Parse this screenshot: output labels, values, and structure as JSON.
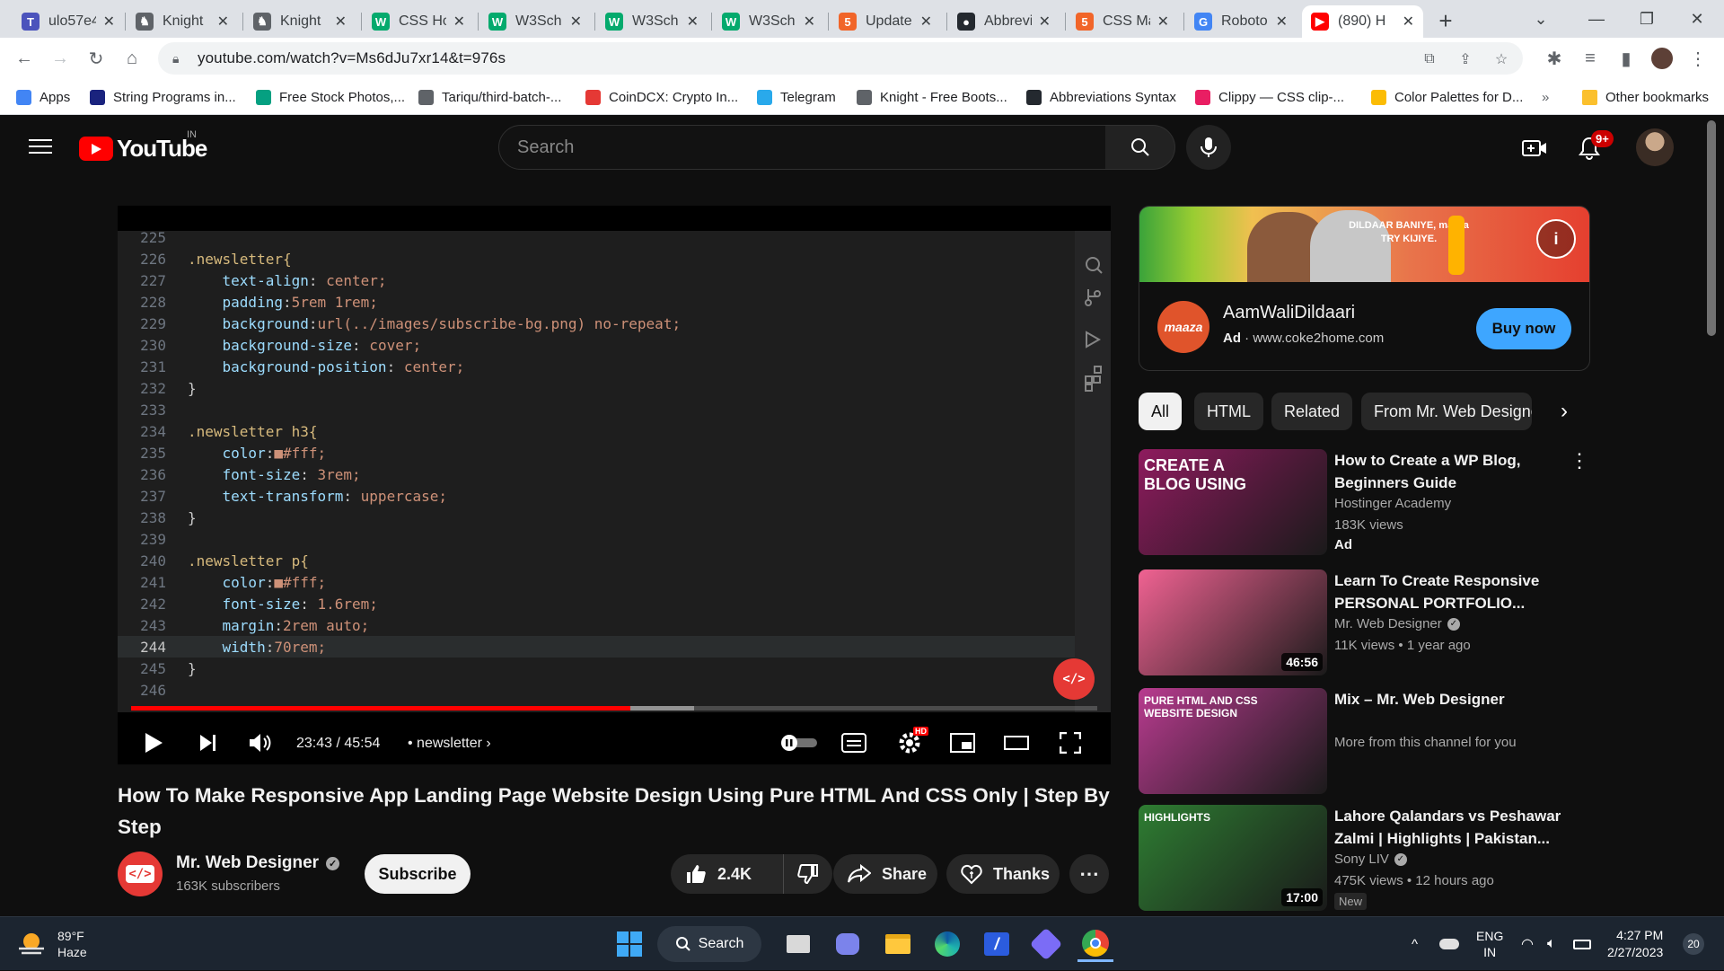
{
  "browser": {
    "tabs": [
      {
        "label": "ulo57e4",
        "icon": "teams-icon",
        "color": "#4b53bc"
      },
      {
        "label": "Knight",
        "icon": "knight-icon",
        "color": "#5f6368"
      },
      {
        "label": "Knight",
        "icon": "knight-icon",
        "color": "#5f6368"
      },
      {
        "label": "CSS Ho",
        "icon": "w3schools-icon",
        "color": "#04aa6d"
      },
      {
        "label": "W3Sch",
        "icon": "w3schools-icon",
        "color": "#04aa6d"
      },
      {
        "label": "W3Sch",
        "icon": "w3schools-icon",
        "color": "#04aa6d"
      },
      {
        "label": "W3Sch",
        "icon": "w3schools-icon",
        "color": "#04aa6d"
      },
      {
        "label": "Update",
        "icon": "html-icon",
        "color": "#f16529"
      },
      {
        "label": "Abbrevi",
        "icon": "github-icon",
        "color": "#24292f"
      },
      {
        "label": "CSS Ma",
        "icon": "html-icon",
        "color": "#f16529"
      },
      {
        "label": "Roboto",
        "icon": "fonts-icon",
        "color": "#4285f4"
      },
      {
        "label": "(890) H",
        "icon": "youtube-icon",
        "color": "#ff0000"
      }
    ],
    "url": "youtube.com/watch?v=Ms6dJu7xr14&t=976s",
    "bookmarks": [
      {
        "label": "Apps",
        "color": "#4285f4"
      },
      {
        "label": "String Programs in...",
        "color": "#1a237e"
      },
      {
        "label": "Free Stock Photos,...",
        "color": "#05a081"
      },
      {
        "label": "Tariqu/third-batch-...",
        "color": "#5f6368"
      },
      {
        "label": "CoinDCX: Crypto In...",
        "color": "#e53935"
      },
      {
        "label": "Telegram",
        "color": "#29a9eb"
      },
      {
        "label": "Knight - Free Boots...",
        "color": "#5f6368"
      },
      {
        "label": "Abbreviations Syntax",
        "color": "#24292f"
      },
      {
        "label": "Clippy — CSS clip-...",
        "color": "#e91e63"
      },
      {
        "label": "Color Palettes for D...",
        "color": "#fbbc04"
      }
    ],
    "other_bookmarks": "Other bookmarks",
    "more_bookmarks": "»"
  },
  "youtube": {
    "logo_text": "YouTube",
    "country": "IN",
    "search_placeholder": "Search",
    "notification_count": "9+"
  },
  "player": {
    "code_lines": [
      {
        "n": "225",
        "t": ""
      },
      {
        "n": "226",
        "t": ".newsletter{"
      },
      {
        "n": "227",
        "t": "    text-align: center;"
      },
      {
        "n": "228",
        "t": "    padding:5rem 1rem;"
      },
      {
        "n": "229",
        "t": "    background:url(../images/subscribe-bg.png) no-repeat;"
      },
      {
        "n": "230",
        "t": "    background-size: cover;"
      },
      {
        "n": "231",
        "t": "    background-position: center;"
      },
      {
        "n": "232",
        "t": "}"
      },
      {
        "n": "233",
        "t": ""
      },
      {
        "n": "234",
        "t": ".newsletter h3{"
      },
      {
        "n": "235",
        "t": "    color:■#fff;"
      },
      {
        "n": "236",
        "t": "    font-size: 3rem;"
      },
      {
        "n": "237",
        "t": "    text-transform: uppercase;"
      },
      {
        "n": "238",
        "t": "}"
      },
      {
        "n": "239",
        "t": ""
      },
      {
        "n": "240",
        "t": ".newsletter p{"
      },
      {
        "n": "241",
        "t": "    color:■#fff;"
      },
      {
        "n": "242",
        "t": "    font-size: 1.6rem;"
      },
      {
        "n": "243",
        "t": "    margin:2rem auto;"
      },
      {
        "n": "244",
        "t": "    width:70rem;"
      },
      {
        "n": "245",
        "t": "}"
      },
      {
        "n": "246",
        "t": ""
      }
    ],
    "current_line": "244",
    "time": "23:43 / 45:54",
    "chapter": "• newsletter",
    "progress": 0.517,
    "buffered": 0.583
  },
  "video": {
    "title": "How To Make Responsive App Landing Page Website Design Using Pure HTML And CSS Only | Step By Step",
    "channel": "Mr. Web Designer",
    "subscribers": "163K subscribers",
    "subscribe_label": "Subscribe",
    "likes": "2.4K",
    "share_label": "Share",
    "thanks_label": "Thanks"
  },
  "ad": {
    "banner_text": "DILDAAR BANIYE, maaza TRY KIJIYE.",
    "logo_text": "maaza",
    "name": "AamWaliDildaari",
    "ad_label": "Ad",
    "domain": "www.coke2home.com",
    "cta": "Buy now"
  },
  "chips": [
    "All",
    "HTML",
    "Related",
    "From Mr. Web Designer"
  ],
  "recommendations": [
    {
      "title": "How to Create a WP Blog, Beginners Guide",
      "channel": "Hostinger Academy",
      "views": "183K views",
      "badge": "Ad",
      "duration": "",
      "thumb_text": "CREATE A BLOG USING",
      "thumb_color": "#8e1b5e"
    },
    {
      "title": "Learn To Create Responsive PERSONAL PORTFOLIO...",
      "channel": "Mr. Web Designer",
      "views": "11K views • 1 year ago",
      "badge": "",
      "duration": "46:56",
      "thumb_text": "",
      "thumb_color": "#f06292"
    },
    {
      "title": "Mix – Mr. Web Designer",
      "channel": "More from this channel for you",
      "views": "",
      "badge": "",
      "duration": "",
      "thumb_text": "PURE HTML AND CSS WEBSITE DESIGN",
      "thumb_color": "#b83b8f"
    },
    {
      "title": "Lahore Qalandars vs Peshawar Zalmi | Highlights | Pakistan...",
      "channel": "Sony LIV",
      "views": "475K views • 12 hours ago",
      "badge": "New",
      "duration": "17:00",
      "thumb_text": "HIGHLIGHTS",
      "thumb_color": "#2e7d32"
    }
  ],
  "taskbar": {
    "weather_temp": "89°F",
    "weather_desc": "Haze",
    "search_label": "Search",
    "lang1": "ENG",
    "lang2": "IN",
    "time": "4:27 PM",
    "date": "2/27/2023",
    "notif_count": "20"
  }
}
